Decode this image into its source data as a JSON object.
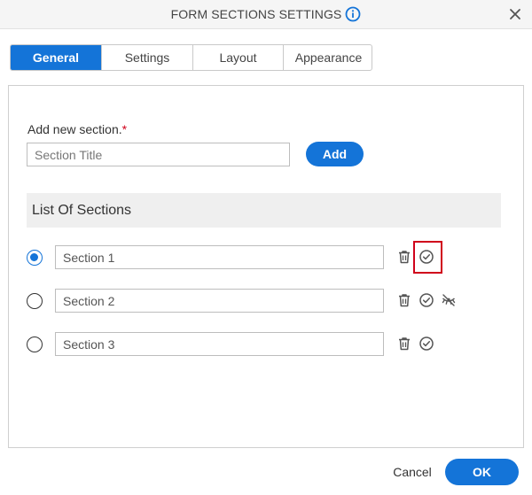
{
  "dialog": {
    "title": "FORM SECTIONS SETTINGS",
    "info_icon": "info-icon",
    "close_icon": "close-icon"
  },
  "tabs": [
    {
      "label": "General",
      "active": true
    },
    {
      "label": "Settings",
      "active": false
    },
    {
      "label": "Layout",
      "active": false
    },
    {
      "label": "Appearance",
      "active": false
    }
  ],
  "add_section": {
    "label": "Add new section.",
    "required_marker": "*",
    "placeholder": "Section Title",
    "button_label": "Add"
  },
  "list": {
    "header": "List Of Sections",
    "sections": [
      {
        "value": "Section 1",
        "selected": true,
        "actions": [
          "trash-icon",
          "check-circle-icon"
        ]
      },
      {
        "value": "Section 2",
        "selected": false,
        "actions": [
          "trash-icon",
          "check-circle-icon",
          "hide-icon"
        ]
      },
      {
        "value": "Section 3",
        "selected": false,
        "actions": [
          "trash-icon",
          "check-circle-icon"
        ]
      }
    ]
  },
  "footer": {
    "cancel_label": "Cancel",
    "ok_label": "OK"
  },
  "colors": {
    "accent": "#1474d8",
    "highlight": "#d0021b"
  }
}
